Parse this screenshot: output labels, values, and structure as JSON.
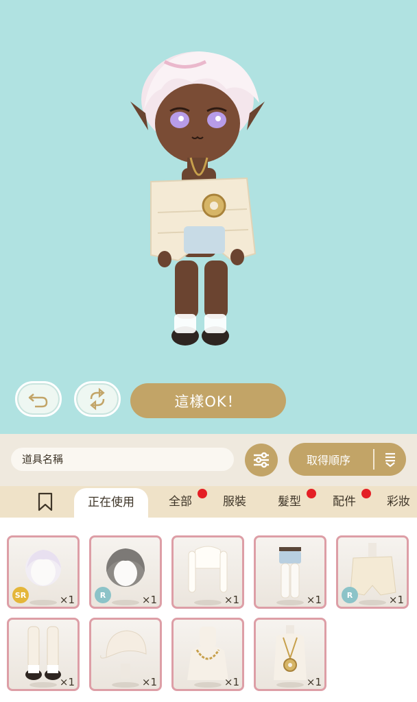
{
  "preview": {
    "confirm_label": "這樣OK！",
    "undo_icon": "undo-arrow-icon",
    "swap_icon": "swap-arrows-icon"
  },
  "toolbar": {
    "search_placeholder": "道具名稱",
    "filter_icon": "sliders-icon",
    "sort_label": "取得順序",
    "sort_icon": "sort-down-icon"
  },
  "tabs": [
    {
      "label": "正在使用",
      "active": true,
      "badge": false
    },
    {
      "label": "全部",
      "active": false,
      "badge": true
    },
    {
      "label": "服裝",
      "active": false,
      "badge": false
    },
    {
      "label": "髮型",
      "active": false,
      "badge": true
    },
    {
      "label": "配件",
      "active": false,
      "badge": true
    },
    {
      "label": "彩妝",
      "active": false,
      "badge": false
    }
  ],
  "items": [
    {
      "name": "hair-white",
      "rarity": "SR",
      "qty": "×1"
    },
    {
      "name": "hair-grey",
      "rarity": "R",
      "qty": "×1"
    },
    {
      "name": "top-cream",
      "rarity": "",
      "qty": "×1"
    },
    {
      "name": "shorts-denim",
      "rarity": "",
      "qty": "×1"
    },
    {
      "name": "shawl-cream",
      "rarity": "R",
      "qty": "×1"
    },
    {
      "name": "sandals",
      "rarity": "",
      "qty": "×1"
    },
    {
      "name": "hat",
      "rarity": "",
      "qty": "×1"
    },
    {
      "name": "chain-necklace",
      "rarity": "",
      "qty": "×1"
    },
    {
      "name": "ring-necklace",
      "rarity": "",
      "qty": "×1"
    }
  ],
  "colors": {
    "stage_bg": "#b0e2e1",
    "accent_gold": "#c2a467",
    "tab_bar": "#efe2c8",
    "item_border": "#dd9ea6",
    "badge_red": "#e41f25"
  }
}
